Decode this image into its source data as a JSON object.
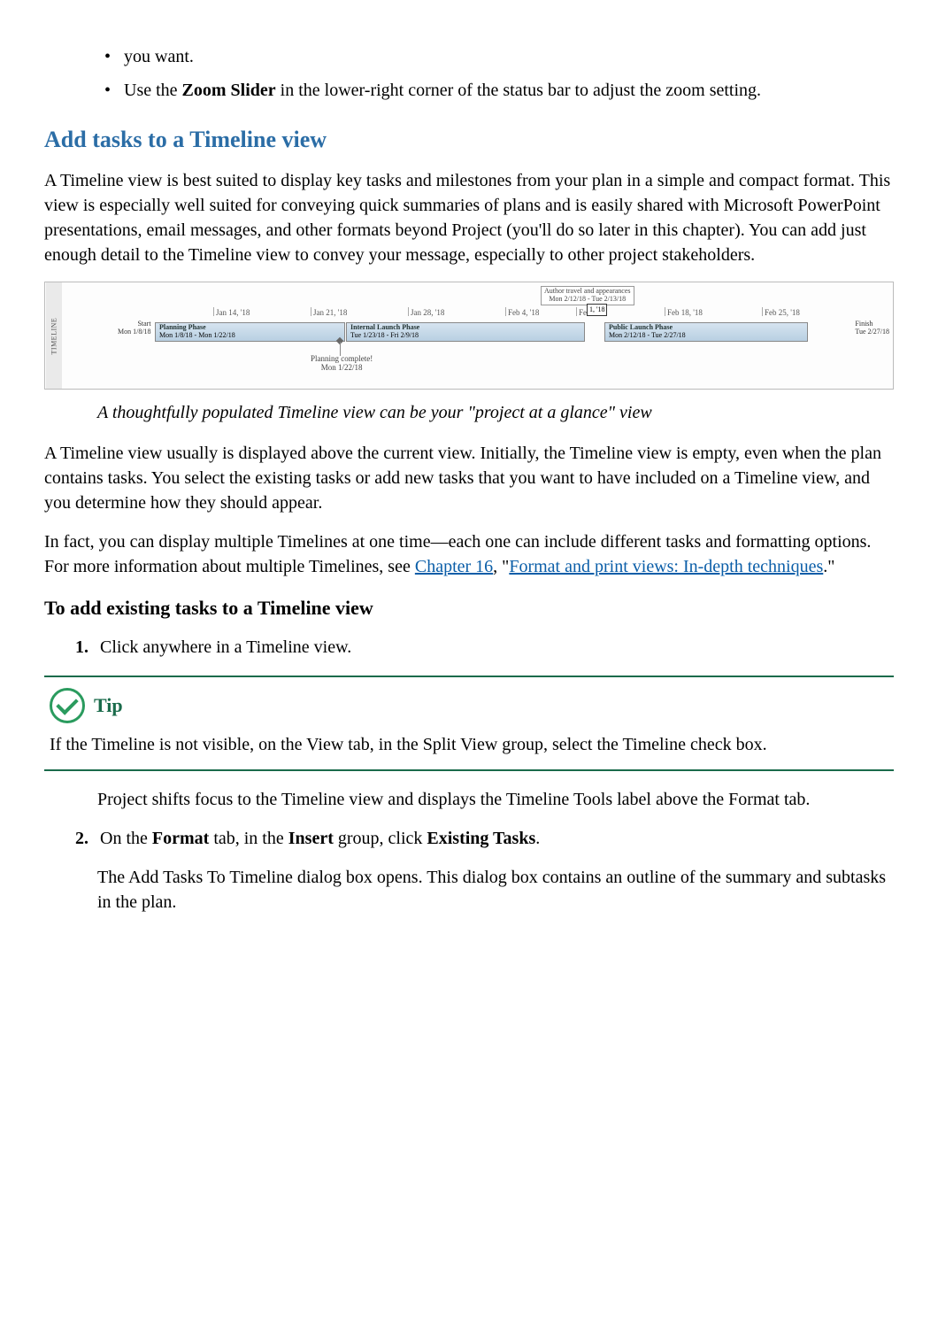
{
  "intro_bullets": {
    "b1_suffix": "you want.",
    "b2_prefix": "Use the ",
    "b2_bold": "Zoom Slider",
    "b2_suffix": " in the lower-right corner of the status bar to adjust the zoom setting."
  },
  "heading1": "Add tasks to a Timeline view",
  "para1": "A Timeline view is best suited to display key tasks and milestones from your plan in a simple and compact format. This view is especially well suited for conveying quick summaries of plans and is easily shared with Microsoft PowerPoint presentations, email messages, and other formats beyond Project (you'll do so later in this chapter). You can add just enough detail to the Timeline view to convey your message, especially to other project stakeholders.",
  "timeline": {
    "vertical_label": "TIMELINE",
    "top_callout_title": "Author travel and appearances",
    "top_callout_dates": "Mon 2/12/18 - Tue 2/13/18",
    "ticks": [
      "Jan 14, '18",
      "Jan 21, '18",
      "Jan 28, '18",
      "Feb 4, '18",
      "Feb",
      "Feb 18, '18",
      "Feb 25, '18"
    ],
    "today_label": "1, '18",
    "start_label": "Start",
    "start_date": "Mon 1/8/18",
    "finish_label": "Finish",
    "finish_date": "Tue 2/27/18",
    "bars": [
      {
        "title": "Planning Phase",
        "dates": "Mon 1/8/18 - Mon 1/22/18"
      },
      {
        "title": "Internal Launch Phase",
        "dates": "Tue 1/23/18 - Fri 2/9/18"
      },
      {
        "title": "Public Launch Phase",
        "dates": "Mon 2/12/18 - Tue 2/27/18"
      }
    ],
    "milestone_label": "Planning complete!",
    "milestone_date": "Mon 1/22/18"
  },
  "caption": "A thoughtfully populated Timeline view can be your \"project at a glance\" view",
  "para2": "A Timeline view usually is displayed above the current view. Initially, the Timeline view is empty, even when the plan contains tasks. You select the existing tasks or add new tasks that you want to have included on a Timeline view, and you determine how they should appear.",
  "para3_prefix": "In fact, you can display multiple Timelines at one time—each one can include different tasks and formatting options. For more information about multiple Timelines, see ",
  "para3_link1": "Chapter 16",
  "para3_mid": ", \"",
  "para3_link2": "Format and print views: In-depth techniques",
  "para3_suffix": ".\"",
  "heading2": "To add existing tasks to a Timeline view",
  "steps": {
    "s1_num": "1.",
    "s1_text": "Click anywhere in a Timeline view.",
    "s1_result": "Project shifts focus to the Timeline view and displays the Timeline Tools label above the Format tab.",
    "s2_num": "2.",
    "s2_pre": "On the ",
    "s2_b1": "Format",
    "s2_mid1": " tab, in the ",
    "s2_b2": "Insert",
    "s2_mid2": " group, click ",
    "s2_b3": "Existing Tasks",
    "s2_suf": ".",
    "s2_result": "The Add Tasks To Timeline dialog box opens. This dialog box contains an outline of the summary and subtasks in the plan."
  },
  "tip": {
    "label": "Tip",
    "body": "If the Timeline is not visible, on the View tab, in the Split View group, select the Timeline check box."
  }
}
